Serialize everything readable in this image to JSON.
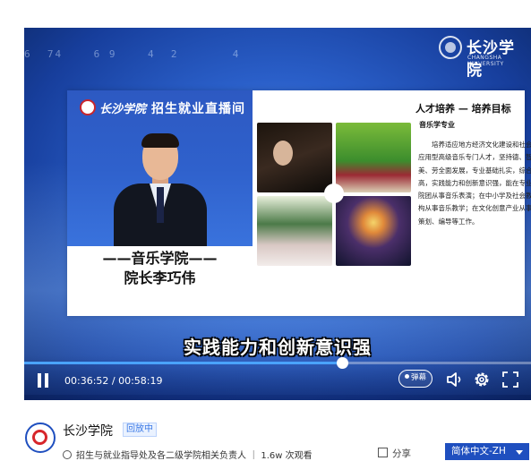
{
  "player": {
    "deco_digits": "6  74    6 9    4  2       4",
    "brand_logo": {
      "name": "长沙学院",
      "en": "CHANGSHA UNIVERSITY"
    },
    "live_banner": {
      "school": "长沙学院",
      "title": "招生就业直播间"
    },
    "presenter_caption": {
      "line1": "——音乐学院——",
      "line2": "院长李巧伟"
    },
    "slide": {
      "title": "人才培养 — 培养目标",
      "subtitle": "音乐学专业",
      "body_lines": [
        "　　培养适应地方经济文化建设和社会需要的",
        "应用型高级音乐专门人才，坚持德、智、体、",
        "美、劳全面发展，专业基础扎实，综合素养",
        "高，实践能力和创新意识强，能在专业艺术",
        "院团从事音乐表演；在中小学及社会教育机",
        "构从事音乐教学；在文化创意产业从事创作、",
        "策划、编导等工作。"
      ]
    },
    "subtitle_text": "实践能力和创新意识强",
    "progress_fraction": 0.6271,
    "current_time": "00:36:52",
    "duration": "00:58:19",
    "time_display": "00:36:52 / 00:58:19",
    "danmaku_label": "弹幕",
    "icons": [
      "pause-icon",
      "volume-icon",
      "settings-icon",
      "fullscreen-icon"
    ]
  },
  "channel": {
    "name": "长沙学院",
    "replay_badge": "回放中",
    "meta_text": "招生与就业指导处及各二级学院相关负责人  ｜  1.6w 次观看",
    "share_label": "分享",
    "language_select": "简体中文-ZH"
  },
  "colors": {
    "accent": "#1f4fbf",
    "progress": "#4aa3ff",
    "badge": "#3a78e6"
  }
}
